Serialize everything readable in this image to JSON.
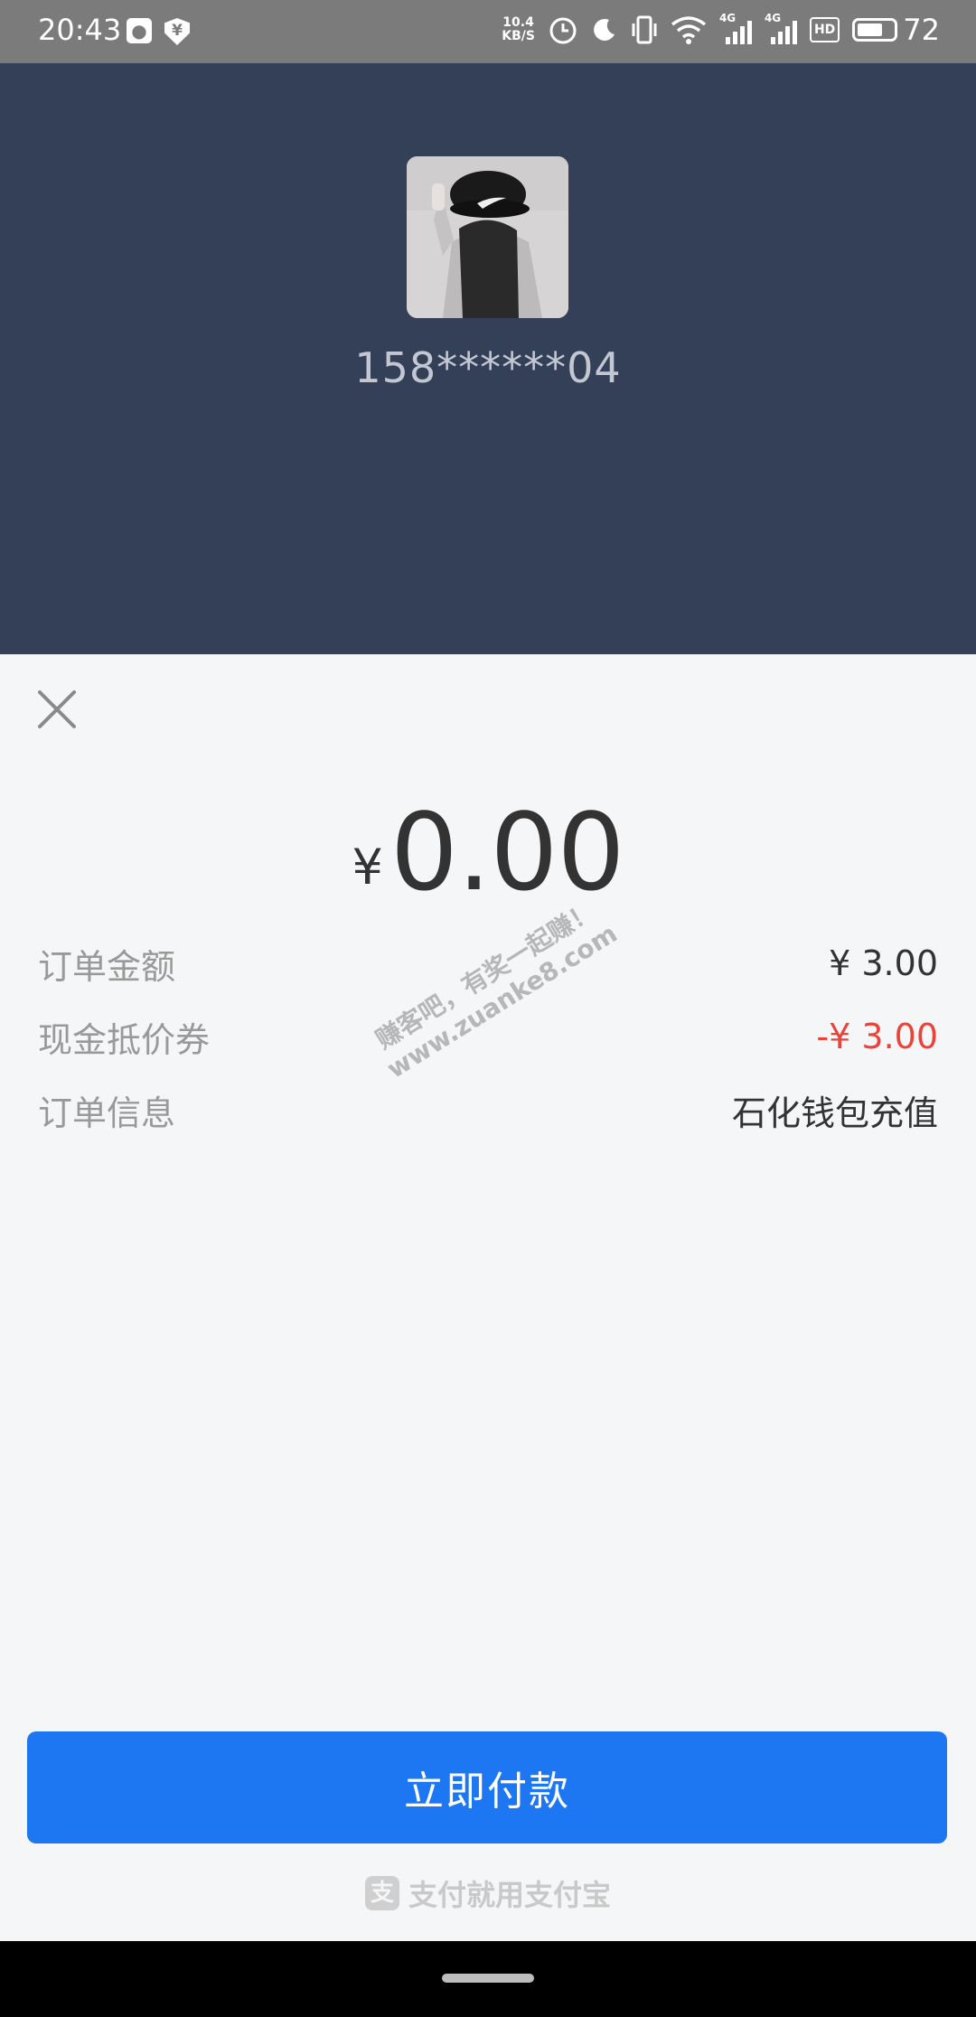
{
  "status_bar": {
    "time": "20:43",
    "speed_value": "10.4",
    "speed_unit": "KB/S",
    "sim1_label": "4G",
    "sim2_label": "4G",
    "hd_label": "HD",
    "battery": "72",
    "battery_level": 0.72
  },
  "header": {
    "username": "158******04"
  },
  "payment": {
    "currency_symbol": "¥",
    "amount": "0.00",
    "details": [
      {
        "label": "订单金额",
        "value": "¥ 3.00"
      },
      {
        "label": "现金抵价券",
        "value": "-¥ 3.00"
      },
      {
        "label": "订单信息",
        "value": "石化钱包充值"
      }
    ],
    "pay_button": "立即付款",
    "brand_logo": "支",
    "brand_text": "支付就用支付宝"
  },
  "watermark": {
    "line1": "赚客吧，有奖一起赚！",
    "line2": "www.zuanke8.com"
  },
  "colors": {
    "header_bg": "#344058",
    "primary": "#1d77f2",
    "discount_red": "#e9443a"
  }
}
